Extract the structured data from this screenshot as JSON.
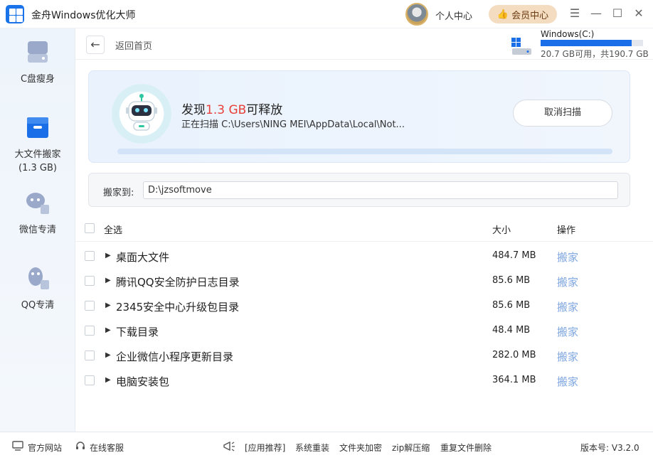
{
  "app": {
    "title": "金舟Windows优化大师"
  },
  "header": {
    "user_center": "个人中心",
    "vip_label": "会员中心",
    "icons": [
      "menu-icon",
      "minimize-icon",
      "maximize-icon",
      "close-icon"
    ]
  },
  "sidebar": {
    "items": [
      {
        "label": "C盘瘦身",
        "icon": "disk-icon"
      },
      {
        "label": "大文件搬家",
        "sub": "(1.3 GB)",
        "icon": "box-icon",
        "active": true
      },
      {
        "label": "微信专清",
        "icon": "wechat-icon"
      },
      {
        "label": "QQ专清",
        "icon": "qq-icon"
      }
    ]
  },
  "nav": {
    "back_label": "返回首页"
  },
  "disk": {
    "name": "Windows(C:)",
    "info": "20.7 GB可用，共190.7 GB",
    "used_fraction": 0.89
  },
  "scan": {
    "found_prefix": "发现",
    "found_value": "1.3 GB",
    "found_suffix": "可释放",
    "path": "正在扫描 C:\\Users\\NING MEI\\AppData\\Local\\Not...",
    "cancel_label": "取消扫描"
  },
  "move": {
    "label": "搬家到:",
    "path": "D:\\jzsoftmove"
  },
  "list": {
    "select_all": "全选",
    "col_size": "大小",
    "col_action": "操作",
    "rows": [
      {
        "name": "桌面大文件",
        "size": "484.7 MB",
        "action": "搬家"
      },
      {
        "name": "腾讯QQ安全防护日志目录",
        "size": "85.6 MB",
        "action": "搬家"
      },
      {
        "name": "2345安全中心升级包目录",
        "size": "85.6 MB",
        "action": "搬家"
      },
      {
        "name": "下载目录",
        "size": "48.4 MB",
        "action": "搬家"
      },
      {
        "name": "企业微信小程序更新目录",
        "size": "282.0 MB",
        "action": "搬家"
      },
      {
        "name": "电脑安装包",
        "size": "364.1 MB",
        "action": "搬家"
      }
    ]
  },
  "footer": {
    "official_site": "官方网站",
    "online_service": "在线客服",
    "recommend": "[应用推荐]",
    "links": [
      "系统重装",
      "文件夹加密",
      "zip解压缩",
      "重复文件删除"
    ],
    "version": "版本号: V3.2.0"
  },
  "colors": {
    "accent": "#1a6fe8",
    "highlight": "#e8403a",
    "link": "#7fa7e0"
  }
}
